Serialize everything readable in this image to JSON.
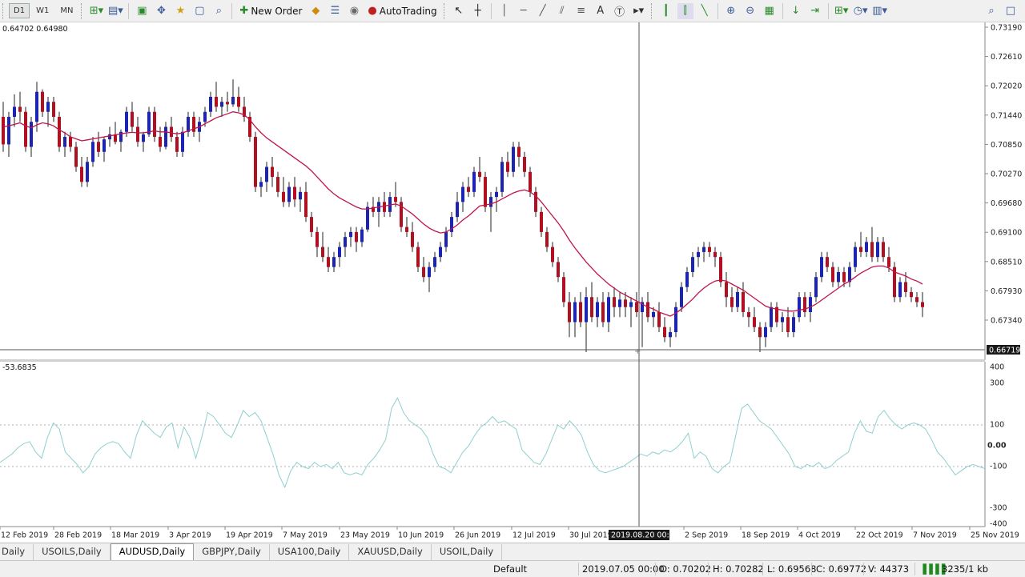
{
  "toolbar": {
    "timeframes": [
      "D1",
      "W1",
      "MN"
    ],
    "active_timeframe": "D1",
    "new_order_label": "New Order",
    "autotrading_label": "AutoTrading"
  },
  "price_chart": {
    "header": "0.64702 0.64980",
    "price_axis": [
      "0.73190",
      "0.72610",
      "0.72020",
      "0.71440",
      "0.70850",
      "0.70270",
      "0.69680",
      "0.69100",
      "0.68510",
      "0.67930",
      "0.67340"
    ],
    "current_price_label": "0.66719",
    "candles": [
      [
        0.714,
        0.717,
        0.707,
        0.7085
      ],
      [
        0.7085,
        0.715,
        0.706,
        0.714
      ],
      [
        0.714,
        0.7185,
        0.712,
        0.716
      ],
      [
        0.716,
        0.719,
        0.713,
        0.715
      ],
      [
        0.715,
        0.716,
        0.707,
        0.708
      ],
      [
        0.708,
        0.714,
        0.706,
        0.713
      ],
      [
        0.713,
        0.721,
        0.711,
        0.719
      ],
      [
        0.719,
        0.7195,
        0.714,
        0.715
      ],
      [
        0.715,
        0.718,
        0.712,
        0.717
      ],
      [
        0.717,
        0.718,
        0.713,
        0.714
      ],
      [
        0.714,
        0.715,
        0.707,
        0.708
      ],
      [
        0.708,
        0.711,
        0.706,
        0.71
      ],
      [
        0.71,
        0.711,
        0.707,
        0.708
      ],
      [
        0.708,
        0.709,
        0.703,
        0.704
      ],
      [
        0.704,
        0.706,
        0.7,
        0.701
      ],
      [
        0.701,
        0.706,
        0.7,
        0.705
      ],
      [
        0.705,
        0.71,
        0.704,
        0.709
      ],
      [
        0.709,
        0.711,
        0.706,
        0.707
      ],
      [
        0.707,
        0.71,
        0.705,
        0.7095
      ],
      [
        0.7095,
        0.712,
        0.708,
        0.7105
      ],
      [
        0.7105,
        0.713,
        0.7085,
        0.709
      ],
      [
        0.709,
        0.7115,
        0.707,
        0.711
      ],
      [
        0.711,
        0.716,
        0.71,
        0.715
      ],
      [
        0.715,
        0.717,
        0.711,
        0.712
      ],
      [
        0.712,
        0.714,
        0.708,
        0.709
      ],
      [
        0.709,
        0.711,
        0.707,
        0.7105
      ],
      [
        0.7105,
        0.716,
        0.71,
        0.715
      ],
      [
        0.715,
        0.716,
        0.709,
        0.71
      ],
      [
        0.71,
        0.712,
        0.707,
        0.708
      ],
      [
        0.708,
        0.713,
        0.7075,
        0.712
      ],
      [
        0.712,
        0.714,
        0.709,
        0.71
      ],
      [
        0.71,
        0.711,
        0.706,
        0.707
      ],
      [
        0.707,
        0.712,
        0.706,
        0.711
      ],
      [
        0.711,
        0.715,
        0.71,
        0.714
      ],
      [
        0.714,
        0.715,
        0.71,
        0.711
      ],
      [
        0.711,
        0.714,
        0.709,
        0.713
      ],
      [
        0.713,
        0.716,
        0.712,
        0.715
      ],
      [
        0.715,
        0.719,
        0.714,
        0.718
      ],
      [
        0.718,
        0.721,
        0.715,
        0.716
      ],
      [
        0.716,
        0.718,
        0.714,
        0.717
      ],
      [
        0.717,
        0.719,
        0.715,
        0.7165
      ],
      [
        0.7165,
        0.7215,
        0.716,
        0.718
      ],
      [
        0.718,
        0.72,
        0.715,
        0.716
      ],
      [
        0.716,
        0.718,
        0.713,
        0.714
      ],
      [
        0.714,
        0.715,
        0.709,
        0.71
      ],
      [
        0.71,
        0.711,
        0.699,
        0.7
      ],
      [
        0.7,
        0.702,
        0.698,
        0.701
      ],
      [
        0.701,
        0.705,
        0.699,
        0.704
      ],
      [
        0.704,
        0.706,
        0.7,
        0.702
      ],
      [
        0.702,
        0.703,
        0.698,
        0.699
      ],
      [
        0.699,
        0.702,
        0.696,
        0.697
      ],
      [
        0.697,
        0.701,
        0.696,
        0.7
      ],
      [
        0.7,
        0.702,
        0.696,
        0.6975
      ],
      [
        0.6975,
        0.7,
        0.695,
        0.699
      ],
      [
        0.699,
        0.701,
        0.693,
        0.694
      ],
      [
        0.694,
        0.695,
        0.69,
        0.691
      ],
      [
        0.691,
        0.692,
        0.686,
        0.688
      ],
      [
        0.688,
        0.691,
        0.685,
        0.686
      ],
      [
        0.686,
        0.688,
        0.683,
        0.684
      ],
      [
        0.684,
        0.687,
        0.683,
        0.686
      ],
      [
        0.686,
        0.689,
        0.684,
        0.688
      ],
      [
        0.688,
        0.691,
        0.686,
        0.69
      ],
      [
        0.69,
        0.692,
        0.688,
        0.691
      ],
      [
        0.691,
        0.692,
        0.687,
        0.689
      ],
      [
        0.689,
        0.692,
        0.688,
        0.6915
      ],
      [
        0.6915,
        0.697,
        0.691,
        0.696
      ],
      [
        0.696,
        0.698,
        0.694,
        0.695
      ],
      [
        0.695,
        0.698,
        0.692,
        0.697
      ],
      [
        0.697,
        0.699,
        0.694,
        0.695
      ],
      [
        0.695,
        0.699,
        0.694,
        0.698
      ],
      [
        0.698,
        0.701,
        0.696,
        0.697
      ],
      [
        0.697,
        0.698,
        0.691,
        0.692
      ],
      [
        0.692,
        0.694,
        0.69,
        0.691
      ],
      [
        0.691,
        0.693,
        0.687,
        0.688
      ],
      [
        0.688,
        0.689,
        0.683,
        0.684
      ],
      [
        0.684,
        0.686,
        0.681,
        0.682
      ],
      [
        0.682,
        0.685,
        0.679,
        0.684
      ],
      [
        0.684,
        0.687,
        0.683,
        0.686
      ],
      [
        0.686,
        0.689,
        0.685,
        0.688
      ],
      [
        0.688,
        0.692,
        0.687,
        0.691
      ],
      [
        0.691,
        0.695,
        0.69,
        0.694
      ],
      [
        0.694,
        0.699,
        0.693,
        0.697
      ],
      [
        0.697,
        0.701,
        0.695,
        0.7
      ],
      [
        0.7,
        0.702,
        0.698,
        0.699
      ],
      [
        0.699,
        0.704,
        0.698,
        0.703
      ],
      [
        0.703,
        0.706,
        0.701,
        0.702
      ],
      [
        0.702,
        0.703,
        0.695,
        0.696
      ],
      [
        0.696,
        0.699,
        0.691,
        0.698
      ],
      [
        0.698,
        0.7,
        0.695,
        0.699
      ],
      [
        0.699,
        0.706,
        0.698,
        0.705
      ],
      [
        0.705,
        0.707,
        0.702,
        0.703
      ],
      [
        0.703,
        0.709,
        0.702,
        0.708
      ],
      [
        0.708,
        0.709,
        0.704,
        0.706
      ],
      [
        0.706,
        0.707,
        0.702,
        0.703
      ],
      [
        0.703,
        0.704,
        0.698,
        0.699
      ],
      [
        0.699,
        0.7,
        0.694,
        0.695
      ],
      [
        0.695,
        0.696,
        0.69,
        0.691
      ],
      [
        0.691,
        0.692,
        0.687,
        0.688
      ],
      [
        0.688,
        0.689,
        0.684,
        0.685
      ],
      [
        0.685,
        0.686,
        0.681,
        0.682
      ],
      [
        0.682,
        0.683,
        0.676,
        0.677
      ],
      [
        0.677,
        0.679,
        0.67,
        0.673
      ],
      [
        0.673,
        0.678,
        0.67,
        0.677
      ],
      [
        0.677,
        0.679,
        0.672,
        0.673
      ],
      [
        0.673,
        0.68,
        0.667,
        0.678
      ],
      [
        0.678,
        0.681,
        0.673,
        0.674
      ],
      [
        0.674,
        0.678,
        0.672,
        0.677
      ],
      [
        0.677,
        0.679,
        0.672,
        0.673
      ],
      [
        0.673,
        0.679,
        0.671,
        0.678
      ],
      [
        0.678,
        0.68,
        0.674,
        0.676
      ],
      [
        0.676,
        0.679,
        0.674,
        0.6775
      ],
      [
        0.6775,
        0.679,
        0.674,
        0.676
      ],
      [
        0.676,
        0.678,
        0.672,
        0.677
      ],
      [
        0.677,
        0.679,
        0.674,
        0.675
      ],
      [
        0.675,
        0.678,
        0.668,
        0.677
      ],
      [
        0.677,
        0.679,
        0.673,
        0.674
      ],
      [
        0.674,
        0.676,
        0.672,
        0.675
      ],
      [
        0.675,
        0.677,
        0.671,
        0.672
      ],
      [
        0.672,
        0.674,
        0.669,
        0.67
      ],
      [
        0.67,
        0.672,
        0.668,
        0.671
      ],
      [
        0.671,
        0.677,
        0.67,
        0.676
      ],
      [
        0.676,
        0.681,
        0.675,
        0.68
      ],
      [
        0.68,
        0.684,
        0.679,
        0.683
      ],
      [
        0.683,
        0.687,
        0.682,
        0.686
      ],
      [
        0.686,
        0.688,
        0.684,
        0.687
      ],
      [
        0.687,
        0.689,
        0.685,
        0.688
      ],
      [
        0.688,
        0.689,
        0.686,
        0.687
      ],
      [
        0.687,
        0.688,
        0.684,
        0.686
      ],
      [
        0.686,
        0.687,
        0.68,
        0.681
      ],
      [
        0.681,
        0.683,
        0.676,
        0.678
      ],
      [
        0.678,
        0.68,
        0.675,
        0.676
      ],
      [
        0.676,
        0.68,
        0.675,
        0.679
      ],
      [
        0.679,
        0.681,
        0.674,
        0.675
      ],
      [
        0.675,
        0.676,
        0.672,
        0.674
      ],
      [
        0.674,
        0.676,
        0.671,
        0.672
      ],
      [
        0.672,
        0.673,
        0.667,
        0.67
      ],
      [
        0.67,
        0.673,
        0.668,
        0.672
      ],
      [
        0.672,
        0.677,
        0.671,
        0.676
      ],
      [
        0.676,
        0.677,
        0.672,
        0.673
      ],
      [
        0.673,
        0.675,
        0.671,
        0.674
      ],
      [
        0.674,
        0.676,
        0.67,
        0.671
      ],
      [
        0.671,
        0.675,
        0.67,
        0.674
      ],
      [
        0.674,
        0.679,
        0.673,
        0.678
      ],
      [
        0.678,
        0.679,
        0.674,
        0.675
      ],
      [
        0.675,
        0.679,
        0.673,
        0.678
      ],
      [
        0.678,
        0.683,
        0.677,
        0.682
      ],
      [
        0.682,
        0.687,
        0.681,
        0.686
      ],
      [
        0.686,
        0.687,
        0.683,
        0.684
      ],
      [
        0.684,
        0.685,
        0.68,
        0.681
      ],
      [
        0.681,
        0.684,
        0.68,
        0.683
      ],
      [
        0.683,
        0.684,
        0.68,
        0.681
      ],
      [
        0.681,
        0.685,
        0.68,
        0.684
      ],
      [
        0.684,
        0.689,
        0.683,
        0.688
      ],
      [
        0.688,
        0.691,
        0.686,
        0.687
      ],
      [
        0.687,
        0.69,
        0.686,
        0.689
      ],
      [
        0.689,
        0.692,
        0.685,
        0.686
      ],
      [
        0.686,
        0.69,
        0.685,
        0.689
      ],
      [
        0.689,
        0.69,
        0.685,
        0.686
      ],
      [
        0.686,
        0.688,
        0.683,
        0.684
      ],
      [
        0.684,
        0.685,
        0.677,
        0.678
      ],
      [
        0.678,
        0.682,
        0.677,
        0.681
      ],
      [
        0.681,
        0.683,
        0.678,
        0.679
      ],
      [
        0.679,
        0.68,
        0.677,
        0.678
      ],
      [
        0.678,
        0.679,
        0.676,
        0.677
      ],
      [
        0.677,
        0.679,
        0.674,
        0.676
      ]
    ],
    "moving_average": [
      0.712,
      0.7122,
      0.7125,
      0.7128,
      0.7122,
      0.7118,
      0.7124,
      0.7128,
      0.7126,
      0.7122,
      0.7114,
      0.7108,
      0.71,
      0.7096,
      0.7092,
      0.7094,
      0.7096,
      0.7098,
      0.71,
      0.7102,
      0.7104,
      0.7106,
      0.7108,
      0.7109,
      0.7108,
      0.7108,
      0.711,
      0.7112,
      0.711,
      0.711,
      0.7108,
      0.7106,
      0.7108,
      0.7112,
      0.7116,
      0.712,
      0.7126,
      0.7132,
      0.7138,
      0.7142,
      0.7146,
      0.715,
      0.7148,
      0.7144,
      0.7134,
      0.712,
      0.7108,
      0.7098,
      0.709,
      0.7082,
      0.7074,
      0.7066,
      0.7058,
      0.705,
      0.7042,
      0.7032,
      0.702,
      0.7008,
      0.6996,
      0.6986,
      0.6978,
      0.6972,
      0.6966,
      0.696,
      0.6956,
      0.6956,
      0.6958,
      0.696,
      0.6962,
      0.6964,
      0.6966,
      0.6962,
      0.6954,
      0.6946,
      0.6936,
      0.6926,
      0.6918,
      0.6912,
      0.6908,
      0.691,
      0.6916,
      0.6924,
      0.6934,
      0.6942,
      0.6952,
      0.6962,
      0.6964,
      0.6966,
      0.697,
      0.6976,
      0.6982,
      0.6988,
      0.6992,
      0.6994,
      0.699,
      0.6982,
      0.697,
      0.6956,
      0.6942,
      0.6928,
      0.6912,
      0.6894,
      0.6878,
      0.6864,
      0.685,
      0.6838,
      0.6826,
      0.6816,
      0.6806,
      0.6798,
      0.679,
      0.6784,
      0.6778,
      0.6772,
      0.6766,
      0.676,
      0.6756,
      0.675,
      0.6746,
      0.6742,
      0.6748,
      0.6756,
      0.6766,
      0.6776,
      0.6788,
      0.6798,
      0.6806,
      0.6812,
      0.6814,
      0.6812,
      0.6806,
      0.68,
      0.6794,
      0.6786,
      0.6778,
      0.677,
      0.6762,
      0.6758,
      0.6756,
      0.6754,
      0.6752,
      0.6752,
      0.6754,
      0.6756,
      0.676,
      0.6766,
      0.6774,
      0.6782,
      0.679,
      0.6798,
      0.6806,
      0.6812,
      0.682,
      0.6828,
      0.6834,
      0.684,
      0.6842,
      0.6842,
      0.6838,
      0.683,
      0.6826,
      0.6822,
      0.6816,
      0.6812,
      0.6806
    ],
    "colors": {
      "bull": "#1c24b4",
      "bear": "#b01020",
      "ma": "#c0144a"
    }
  },
  "indicator": {
    "header": "-53.6835",
    "axis": [
      "400",
      "300",
      "100",
      "0.00",
      "-100",
      "-300",
      "-400"
    ],
    "values": [
      -80,
      -60,
      -40,
      -10,
      10,
      20,
      -30,
      -60,
      40,
      110,
      80,
      -30,
      -60,
      -90,
      -130,
      -100,
      -40,
      -10,
      10,
      20,
      10,
      -30,
      -60,
      50,
      120,
      90,
      60,
      40,
      90,
      110,
      -10,
      90,
      40,
      -60,
      40,
      160,
      140,
      100,
      60,
      40,
      100,
      170,
      140,
      160,
      120,
      40,
      -40,
      -140,
      -200,
      -120,
      -80,
      -100,
      -110,
      -80,
      -100,
      -90,
      -110,
      -80,
      -130,
      -140,
      -130,
      -140,
      -90,
      -60,
      -20,
      30,
      180,
      230,
      160,
      120,
      100,
      80,
      40,
      -40,
      -100,
      -110,
      -130,
      -80,
      -30,
      0,
      50,
      90,
      110,
      140,
      110,
      120,
      100,
      80,
      -20,
      -50,
      -80,
      -90,
      -40,
      30,
      100,
      80,
      120,
      90,
      50,
      -30,
      -90,
      -120,
      -130,
      -120,
      -110,
      -100,
      -80,
      -60,
      -40,
      -50,
      -30,
      -40,
      -20,
      -30,
      -10,
      20,
      60,
      -60,
      -30,
      -50,
      -110,
      -130,
      -100,
      -80,
      50,
      180,
      200,
      160,
      120,
      100,
      80,
      40,
      0,
      -40,
      -100,
      -110,
      -90,
      -100,
      -80,
      -110,
      -100,
      -70,
      -50,
      -30,
      60,
      120,
      70,
      60,
      140,
      170,
      130,
      100,
      80,
      100,
      110,
      100,
      80,
      30,
      -30,
      -60,
      -100,
      -140,
      -120,
      -100,
      -90,
      -100,
      -110
    ],
    "color": "#8fcfcf"
  },
  "time_axis": [
    "12 Feb 2019",
    "28 Feb 2019",
    "18 Mar 2019",
    "3 Apr 2019",
    "19 Apr 2019",
    "7 May 2019",
    "23 May 2019",
    "10 Jun 2019",
    "26 Jun 2019",
    "12 Jul 2019",
    "30 Jul 2019",
    "2 Sep 2019",
    "18 Sep 2019",
    "4 Oct 2019",
    "22 Oct 2019",
    "7 Nov 2019",
    "25 Nov 2019"
  ],
  "crosshair_time": "2019.08.20 00:00",
  "tabs": [
    {
      "label": "Daily"
    },
    {
      "label": "USOILS,Daily"
    },
    {
      "label": "AUDUSD,Daily"
    },
    {
      "label": "GBPJPY,Daily"
    },
    {
      "label": "USA100,Daily"
    },
    {
      "label": "XAUUSD,Daily"
    },
    {
      "label": "USOIL,Daily"
    }
  ],
  "active_tab": "AUDUSD,Daily",
  "status": {
    "profile": "Default",
    "datetime": "2019.07.05 00:00",
    "open": "O: 0.70202",
    "high": "H: 0.70282",
    "low": "L: 0.69568",
    "close": "C: 0.69772",
    "volume": "V: 44373",
    "traffic": "3235/1 kb"
  }
}
